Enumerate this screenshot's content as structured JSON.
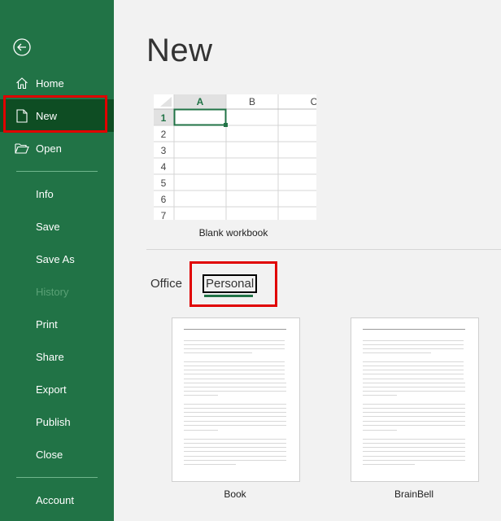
{
  "sidebar": {
    "back_icon": "back-arrow-circle-icon",
    "items": [
      {
        "label": "Home",
        "icon": "home-icon",
        "state": "normal"
      },
      {
        "label": "New",
        "icon": "new-document-icon",
        "state": "selected"
      },
      {
        "label": "Open",
        "icon": "folder-open-icon",
        "state": "normal"
      },
      {
        "label": "Info",
        "state": "normal"
      },
      {
        "label": "Save",
        "state": "normal"
      },
      {
        "label": "Save As",
        "state": "normal"
      },
      {
        "label": "History",
        "state": "disabled"
      },
      {
        "label": "Print",
        "state": "normal"
      },
      {
        "label": "Share",
        "state": "normal"
      },
      {
        "label": "Export",
        "state": "normal"
      },
      {
        "label": "Publish",
        "state": "normal"
      },
      {
        "label": "Close",
        "state": "normal"
      },
      {
        "label": "Account",
        "state": "normal"
      }
    ]
  },
  "main": {
    "title": "New",
    "blank_workbook": {
      "label": "Blank workbook",
      "columns": [
        "A",
        "B",
        "C"
      ],
      "rows": [
        "1",
        "2",
        "3",
        "4",
        "5",
        "6",
        "7"
      ],
      "active_cell": "A1"
    },
    "tabs": [
      {
        "label": "Office",
        "active": false
      },
      {
        "label": "Personal",
        "active": true
      }
    ],
    "templates": [
      {
        "label": "Book"
      },
      {
        "label": "BrainBell"
      }
    ]
  },
  "colors": {
    "brand": "#217346",
    "selected_nav": "#0e4d23",
    "highlight": "#e00000"
  }
}
